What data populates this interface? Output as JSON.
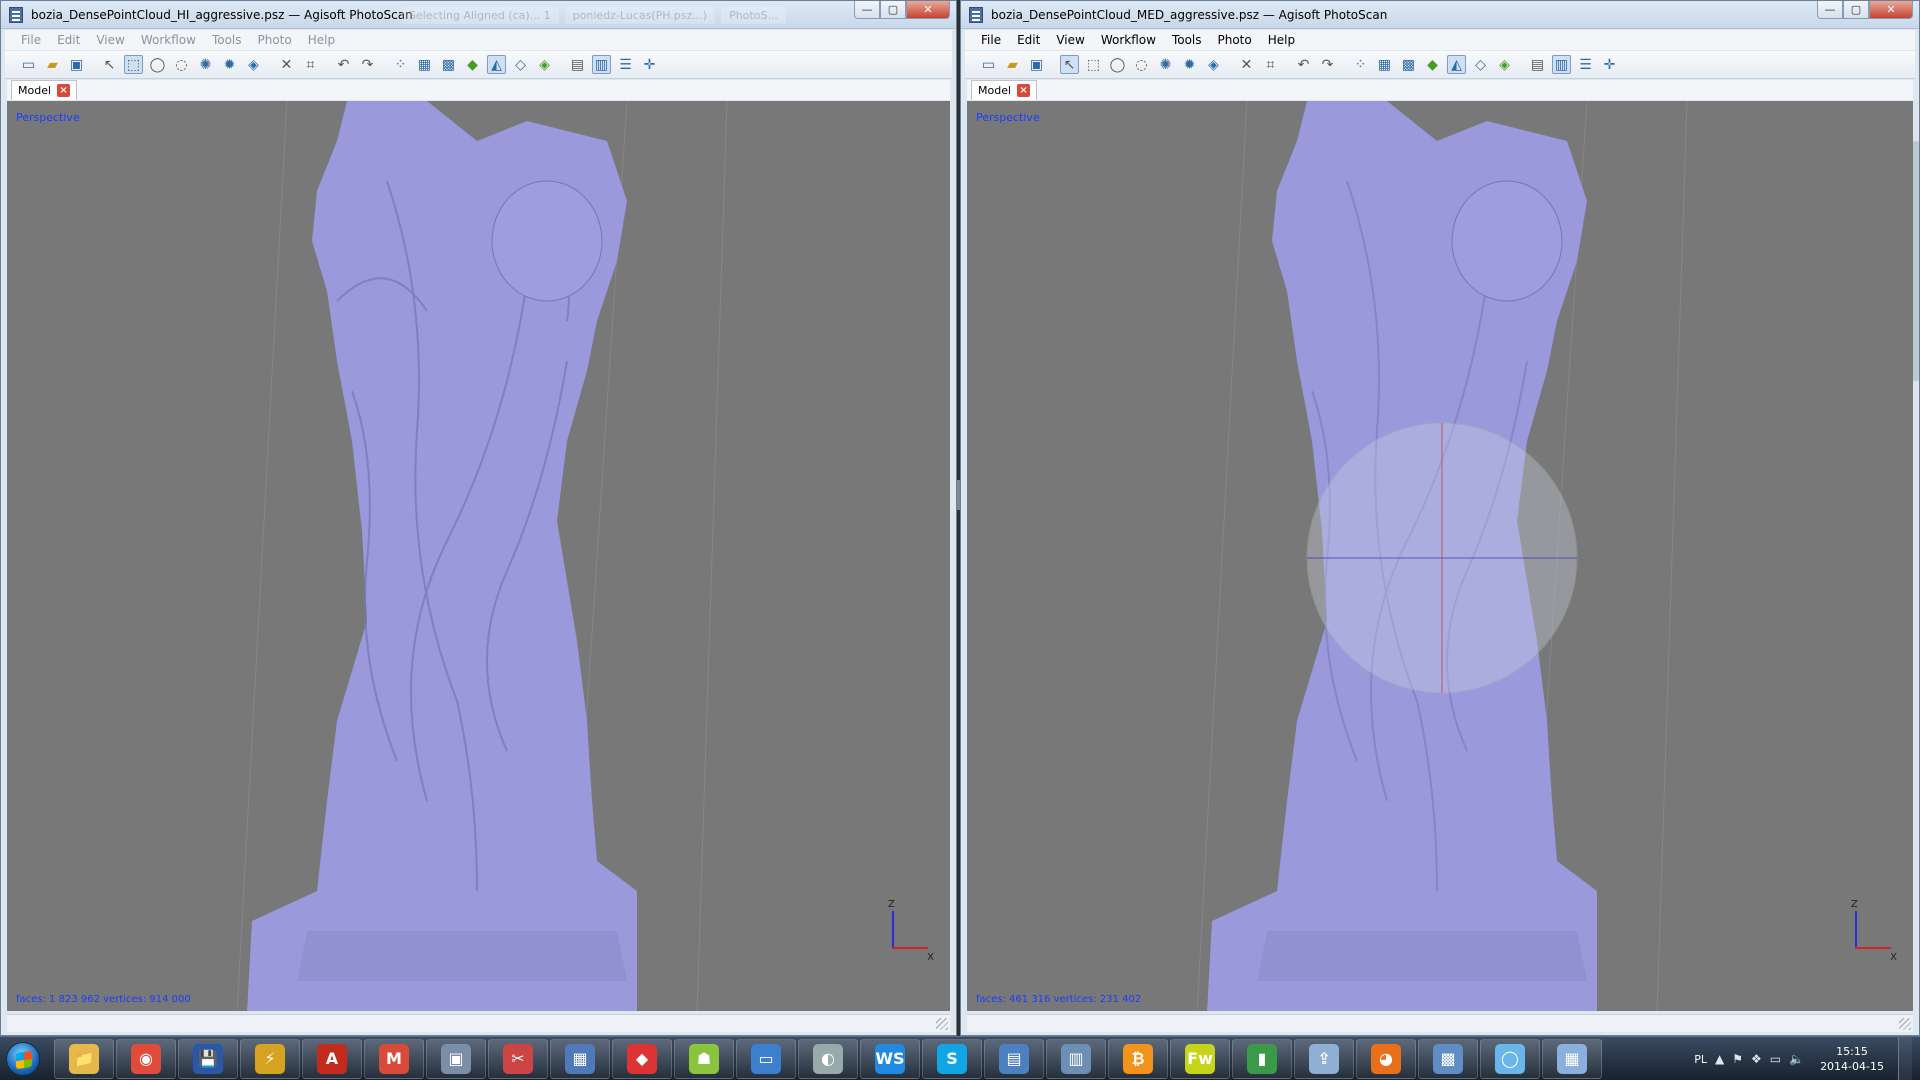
{
  "left_window": {
    "title": "bozia_DensePointCloud_HI_aggressive.psz — Agisoft PhotoScan",
    "ghost_tabs": [
      "Selecting Aligned (ca)... 1",
      "poniedz-Lucas(PH.psz...)",
      "PhotoS..."
    ],
    "menu": [
      "File",
      "Edit",
      "View",
      "Workflow",
      "Tools",
      "Photo",
      "Help"
    ],
    "tab_label": "Model",
    "viewport_label": "Perspective",
    "stats": "faces: 1 823 962 vertices: 914 000"
  },
  "right_window": {
    "title": "bozia_DensePointCloud_MED_aggressive.psz — Agisoft PhotoScan",
    "menu": [
      "File",
      "Edit",
      "View",
      "Workflow",
      "Tools",
      "Photo",
      "Help"
    ],
    "tab_label": "Model",
    "viewport_label": "Perspective",
    "stats": "faces: 461 316 vertices: 231 402"
  },
  "caption_buttons": {
    "minimize": "—",
    "maximize": "▢",
    "close": "✕"
  },
  "axis": {
    "z": "Z",
    "x": "X"
  },
  "toolbar_icons": [
    "new-icon",
    "open-icon",
    "save-icon",
    "sep",
    "pointer-icon",
    "rect-select-icon",
    "ellipse-select-icon",
    "lasso-select-icon",
    "rotate-icon",
    "rotate2-icon",
    "model-icon",
    "sep",
    "delete-icon",
    "crop-icon",
    "sep",
    "undo-icon",
    "redo-icon",
    "sep",
    "grid-icon",
    "grid2-icon",
    "grid3-icon",
    "shaded-icon",
    "solid-icon",
    "wire-icon",
    "texture-icon",
    "sep",
    "camera-icon",
    "region-icon",
    "layers-icon",
    "center-icon"
  ],
  "taskbar": {
    "apps": [
      {
        "name": "explorer",
        "glyph": "📁",
        "color": "#e6b84a"
      },
      {
        "name": "chrome",
        "glyph": "◉",
        "color": "#e04b3a"
      },
      {
        "name": "save-app",
        "glyph": "💾",
        "color": "#2a58a8"
      },
      {
        "name": "winamp",
        "glyph": "⚡",
        "color": "#d6a21f"
      },
      {
        "name": "acrobat",
        "glyph": "A",
        "color": "#c42b1c"
      },
      {
        "name": "gmail",
        "glyph": "M",
        "color": "#d84a3a"
      },
      {
        "name": "virtualbox",
        "glyph": "▣",
        "color": "#7a8ea6"
      },
      {
        "name": "snipping",
        "glyph": "✂",
        "color": "#c44"
      },
      {
        "name": "calculator",
        "glyph": "▦",
        "color": "#4f79b8"
      },
      {
        "name": "sketchup",
        "glyph": "◆",
        "color": "#d33"
      },
      {
        "name": "android",
        "glyph": "☗",
        "color": "#8ac43f"
      },
      {
        "name": "remote",
        "glyph": "▭",
        "color": "#3c7fcc"
      },
      {
        "name": "disk-tool",
        "glyph": "◐",
        "color": "#9aa"
      },
      {
        "name": "ws",
        "glyph": "WS",
        "color": "#1f8ae0"
      },
      {
        "name": "skype",
        "glyph": "S",
        "color": "#12a5e3"
      },
      {
        "name": "photoscan-1",
        "glyph": "▤",
        "color": "#4c80bf"
      },
      {
        "name": "photoscan-2",
        "glyph": "▥",
        "color": "#6d8fb5"
      },
      {
        "name": "bitcoin",
        "glyph": "₿",
        "color": "#f2931c"
      },
      {
        "name": "fireworks",
        "glyph": "Fw",
        "color": "#c7d51a"
      },
      {
        "name": "monitor",
        "glyph": "▮",
        "color": "#3a9a4a"
      },
      {
        "name": "uploader",
        "glyph": "⇪",
        "color": "#8fb0d3"
      },
      {
        "name": "firefox",
        "glyph": "◕",
        "color": "#e8701a"
      },
      {
        "name": "control-panel",
        "glyph": "▩",
        "color": "#5f8dc4"
      },
      {
        "name": "network",
        "glyph": "◯",
        "color": "#6ab6e8"
      },
      {
        "name": "video",
        "glyph": "▦",
        "color": "#8ab0dd"
      }
    ],
    "language": "PL",
    "time": "15:15",
    "date": "2014-04-15"
  }
}
